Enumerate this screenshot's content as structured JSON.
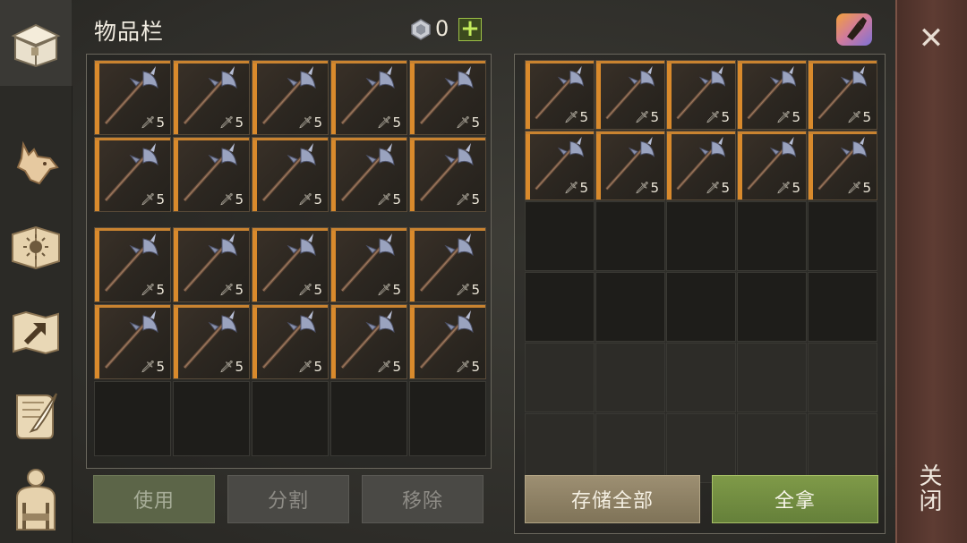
{
  "header": {
    "title": "物品栏",
    "currency_amount": "0",
    "add_label": "+"
  },
  "sidebar": {
    "tabs": [
      {
        "name": "chest",
        "icon": "chest-icon",
        "active": true
      },
      {
        "name": "wolf",
        "icon": "wolf-icon",
        "active": false
      },
      {
        "name": "sun-book",
        "icon": "sun-book-icon",
        "active": false
      },
      {
        "name": "arrow-map",
        "icon": "arrow-map-icon",
        "active": false
      },
      {
        "name": "quill-scroll",
        "icon": "quill-scroll-icon",
        "active": false
      },
      {
        "name": "backpack",
        "icon": "backpack-icon",
        "active": false
      }
    ]
  },
  "inventory": {
    "item_name": "halberd",
    "item_quantity": "5",
    "filled_slots": 20,
    "total_slots": 25
  },
  "storage": {
    "item_name": "halberd",
    "item_quantity": "5",
    "filled_slots": 10,
    "total_slots": 30
  },
  "buttons": {
    "use": "使用",
    "split": "分割",
    "remove": "移除",
    "store_all": "存储全部",
    "take_all": "全拿"
  },
  "close": {
    "label": "关闭",
    "x": "✕"
  },
  "colors": {
    "slot_accent": "#d98a2c",
    "take_all_green": "#7f9a48",
    "close_panel": "#5e3c33"
  }
}
